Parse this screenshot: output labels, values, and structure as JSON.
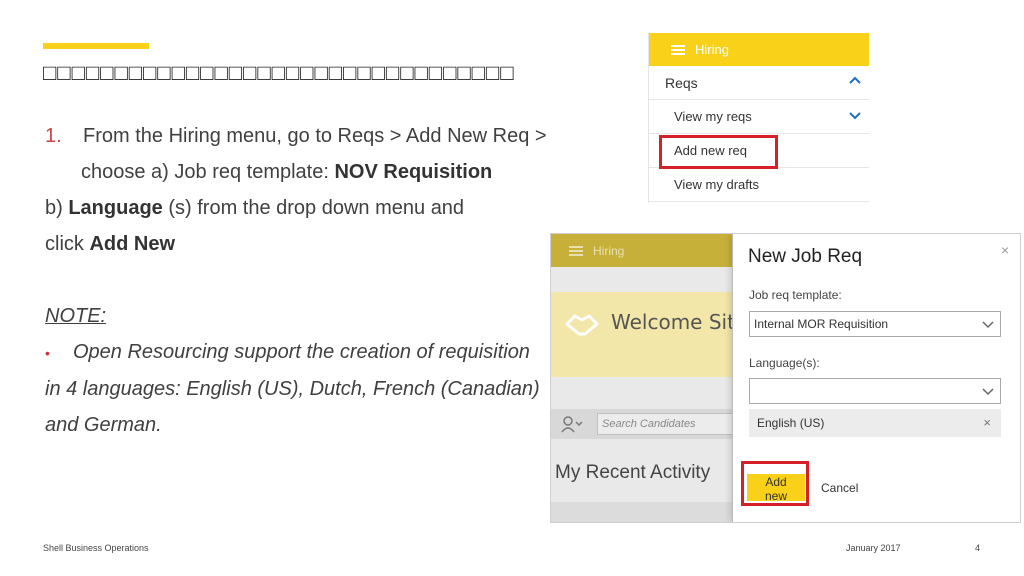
{
  "slide": {
    "title": "□□□□□□□□□□□□□□□□□□□□□□□□□□□□□□□□□",
    "step_number": "1.",
    "step_line1": "From the Hiring menu, go to Reqs > Add New Req >",
    "step_line2_prefix": "choose a) Job req template: ",
    "step_line2_bold": "NOV Requisition",
    "step_line3_prefix": "b) ",
    "step_line3_bold": "Language",
    "step_line3_suffix": " (s) from the drop down menu and",
    "step_line4_prefix": "click ",
    "step_line4_bold": "Add New",
    "note_heading": "NOTE:",
    "note_bullet": "•",
    "note_line1": "Open Resourcing support the creation of requisition",
    "note_line2": "in 4 languages: English (US), Dutch, French (Canadian)",
    "note_line3": "and German."
  },
  "menu": {
    "header": "Hiring",
    "section": "Reqs",
    "items": [
      "View my reqs",
      "Add new req",
      "View my drafts"
    ]
  },
  "dialog_bg": {
    "topbar": "Hiring",
    "welcome": "Welcome Siti Nu",
    "search_placeholder": "Search Candidates",
    "recent": "My Recent Activity"
  },
  "dialog": {
    "title": "New Job Req",
    "close": "×",
    "template_label": "Job req template:",
    "template_value": "Internal MOR Requisition",
    "language_label": "Language(s):",
    "language_value": "",
    "chip": "English (US)",
    "chip_remove": "×",
    "add_button": "Add new",
    "cancel_button": "Cancel"
  },
  "footer": {
    "company": "Shell Business Operations",
    "date": "January 2017",
    "page": "4"
  },
  "colors": {
    "accent": "#f8d118",
    "highlight": "#d62027"
  }
}
